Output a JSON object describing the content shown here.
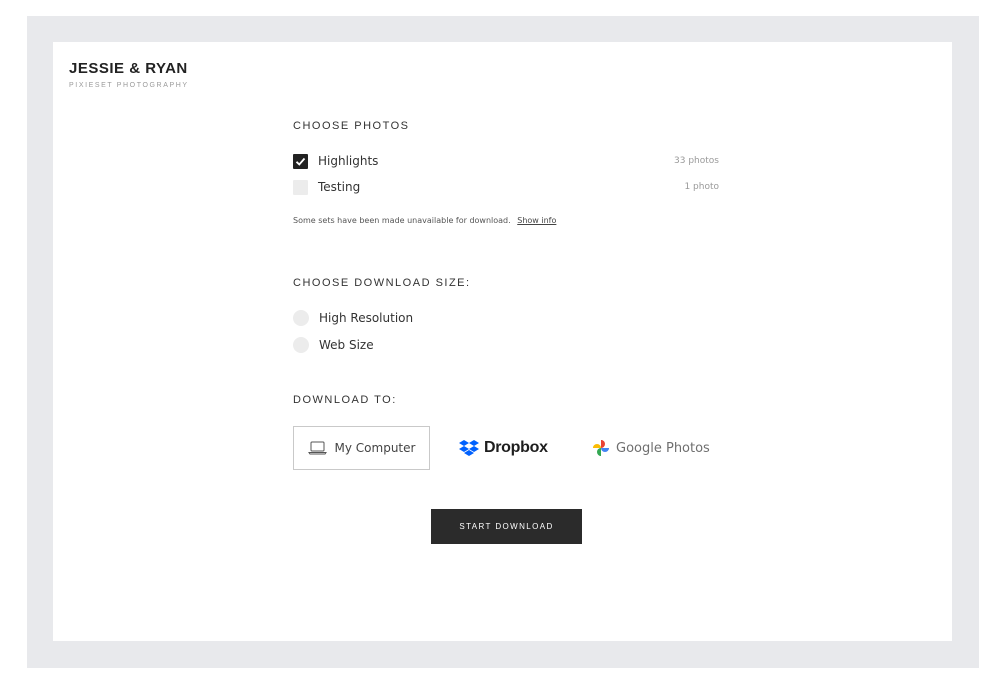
{
  "brand": {
    "title": "JESSIE & RYAN",
    "subtitle": "PIXIESET PHOTOGRAPHY"
  },
  "choose_photos": {
    "title": "CHOOSE PHOTOS",
    "sets": [
      {
        "label": "Highlights",
        "count": "33 photos",
        "checked": true
      },
      {
        "label": "Testing",
        "count": "1 photo",
        "checked": false
      }
    ],
    "note": "Some sets have been made unavailable for download.",
    "show_info": "Show info"
  },
  "download_size": {
    "title": "CHOOSE DOWNLOAD SIZE:",
    "options": [
      {
        "label": "High Resolution",
        "selected": false
      },
      {
        "label": "Web Size",
        "selected": false
      }
    ]
  },
  "download_to": {
    "title": "DOWNLOAD TO:",
    "my_computer": "My Computer",
    "dropbox": "Dropbox",
    "google_photos": "Google Photos"
  },
  "start_button": "START DOWNLOAD",
  "icons": {
    "checkmark": "checkmark-icon",
    "laptop": "laptop-icon",
    "dropbox": "dropbox-logo-icon",
    "google_photos": "google-photos-logo-icon"
  },
  "colors": {
    "frame": "#e8e9ec",
    "button": "#2b2b2b",
    "dropbox_blue": "#0061fe"
  }
}
